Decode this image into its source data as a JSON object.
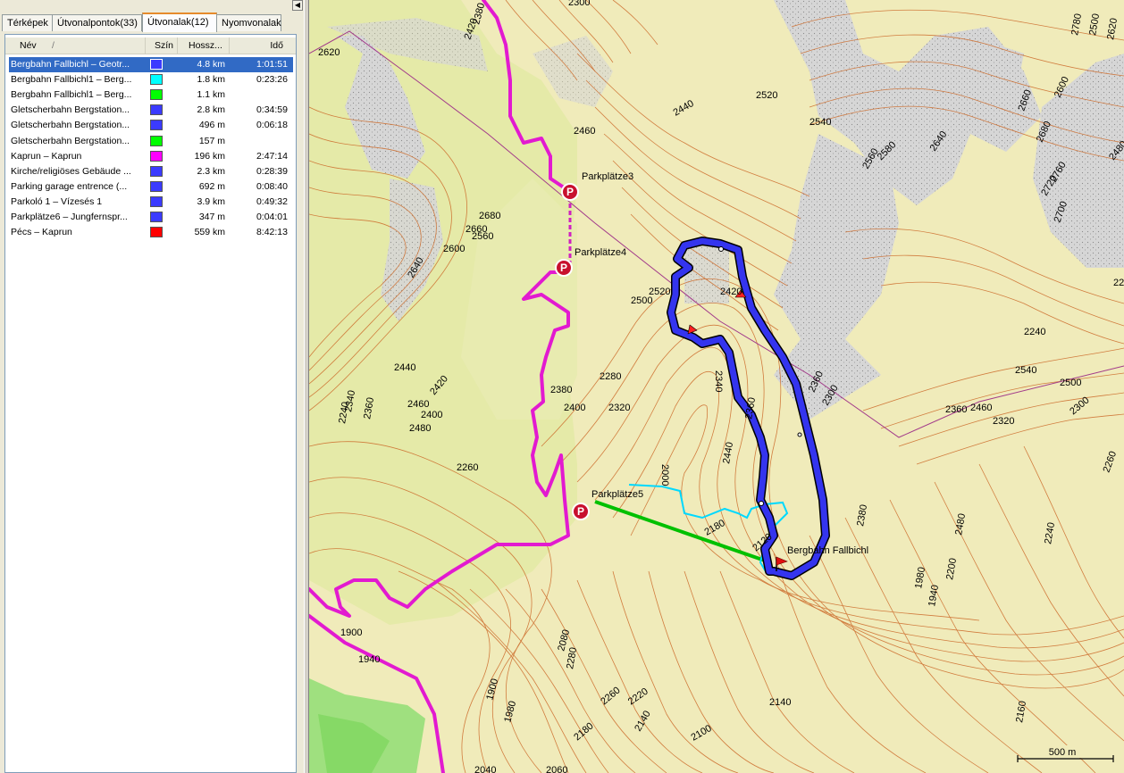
{
  "tabs": [
    {
      "label": "Térképek"
    },
    {
      "label": "Útvonalpontok(33)"
    },
    {
      "label": "Útvonalak(12)"
    },
    {
      "label": "Nyomvonalak"
    }
  ],
  "columns": {
    "name": "Név",
    "sort_indicator": "/",
    "color": "Szín",
    "length": "Hossz...",
    "time": "Idő"
  },
  "routes": [
    {
      "name": "Bergbahn Fallbichl – Geotr...",
      "color": "#3b3bff",
      "length": "4.8 km",
      "time": "1:01:51",
      "selected": true
    },
    {
      "name": "Bergbahn Fallbichl1 – Berg...",
      "color": "#00ffff",
      "length": "1.8 km",
      "time": "0:23:26"
    },
    {
      "name": "Bergbahn Fallbichl1 – Berg...",
      "color": "#00ff00",
      "length": "1.1 km",
      "time": ""
    },
    {
      "name": "Gletscherbahn Bergstation...",
      "color": "#3b3bff",
      "length": "2.8 km",
      "time": "0:34:59"
    },
    {
      "name": "Gletscherbahn Bergstation...",
      "color": "#3b3bff",
      "length": "496 m",
      "time": "0:06:18"
    },
    {
      "name": "Gletscherbahn Bergstation...",
      "color": "#00ff00",
      "length": "157 m",
      "time": ""
    },
    {
      "name": "Kaprun – Kaprun",
      "color": "#ff00ff",
      "length": "196 km",
      "time": "2:47:14"
    },
    {
      "name": "Kirche/religiöses Gebäude ...",
      "color": "#3b3bff",
      "length": "2.3 km",
      "time": "0:28:39"
    },
    {
      "name": "Parking garage entrence (...",
      "color": "#3b3bff",
      "length": "692 m",
      "time": "0:08:40"
    },
    {
      "name": "Parkoló 1 – Vízesés 1",
      "color": "#3b3bff",
      "length": "3.9 km",
      "time": "0:49:32"
    },
    {
      "name": "Parkplätze6 – Jungfernspr...",
      "color": "#3b3bff",
      "length": "347 m",
      "time": "0:04:01"
    },
    {
      "name": "Pécs – Kaprun",
      "color": "#ff0000",
      "length": "559 km",
      "time": "8:42:13"
    }
  ],
  "map": {
    "scale_label": "500 m",
    "pois": [
      {
        "label": "Parkplätze3",
        "icon": "parking-icon"
      },
      {
        "label": "Parkplätze4",
        "icon": "parking-icon"
      },
      {
        "label": "Parkplätze5",
        "icon": "parking-icon"
      },
      {
        "label": "Bergbahn Fallbichl",
        "icon": "flag-icon"
      }
    ],
    "contour_labels": [
      "2380",
      "2420",
      "2300",
      "2620",
      "2520",
      "2460",
      "2440",
      "2480",
      "2580",
      "2560",
      "2540",
      "2640",
      "2600",
      "2660",
      "2680",
      "2700",
      "2720",
      "2760",
      "2780",
      "2500",
      "2620",
      "2680",
      "2660",
      "2600",
      "2640",
      "2560",
      "2520",
      "2500",
      "2440",
      "2460",
      "2420",
      "2400",
      "2480",
      "2340",
      "2360",
      "2380",
      "2400",
      "2320",
      "2280",
      "2260",
      "2240",
      "2340",
      "2360",
      "2440",
      "2420",
      "2360",
      "2300",
      "2280",
      "2240",
      "2540",
      "2500",
      "2460",
      "2360",
      "2320",
      "2300",
      "2260",
      "2180",
      "2120",
      "2000",
      "2380",
      "2480",
      "2240",
      "1980",
      "1940",
      "2200",
      "2140",
      "2080",
      "2280",
      "2220",
      "2260",
      "2180",
      "2140",
      "2100",
      "2160",
      "1900",
      "1940",
      "1900",
      "1980",
      "2040",
      "2060"
    ]
  }
}
